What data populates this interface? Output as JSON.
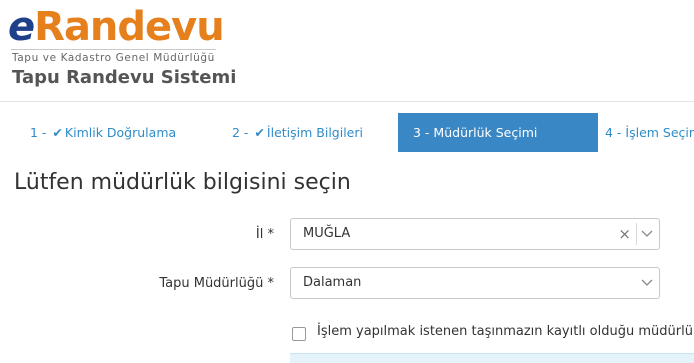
{
  "header": {
    "logo_e": "e",
    "logo_rest": "Randevu",
    "subtitle": "Tapu ve Kadastro Genel Müdürlüğü",
    "system_name": "Tapu Randevu Sistemi"
  },
  "steps": [
    {
      "prefix": "1 -",
      "label": "Kimlik Doğrulama",
      "done": true
    },
    {
      "prefix": "2 -",
      "label": "İletişim Bilgileri",
      "done": true
    },
    {
      "prefix": "3 -",
      "label": "Müdürlük Seçimi",
      "active": true
    },
    {
      "prefix": "4 -",
      "label": "İşlem Seçim"
    }
  ],
  "page_title": "Lütfen müdürlük bilgisini seçin",
  "form": {
    "il_label": "İl *",
    "il_value": "MUĞLA",
    "mudurluk_label": "Tapu Müdürlüğü *",
    "mudurluk_value": "Dalaman",
    "checkbox_label": "İşlem yapılmak istenen taşınmazın kayıtlı olduğu müdürlük fa"
  },
  "icons": {
    "check": "✔",
    "clear": "×"
  },
  "colors": {
    "brand_blue": "#1e3f8a",
    "brand_orange": "#e6801d",
    "step_link": "#2f8cc9",
    "step_active_bg": "#3a87c5"
  }
}
